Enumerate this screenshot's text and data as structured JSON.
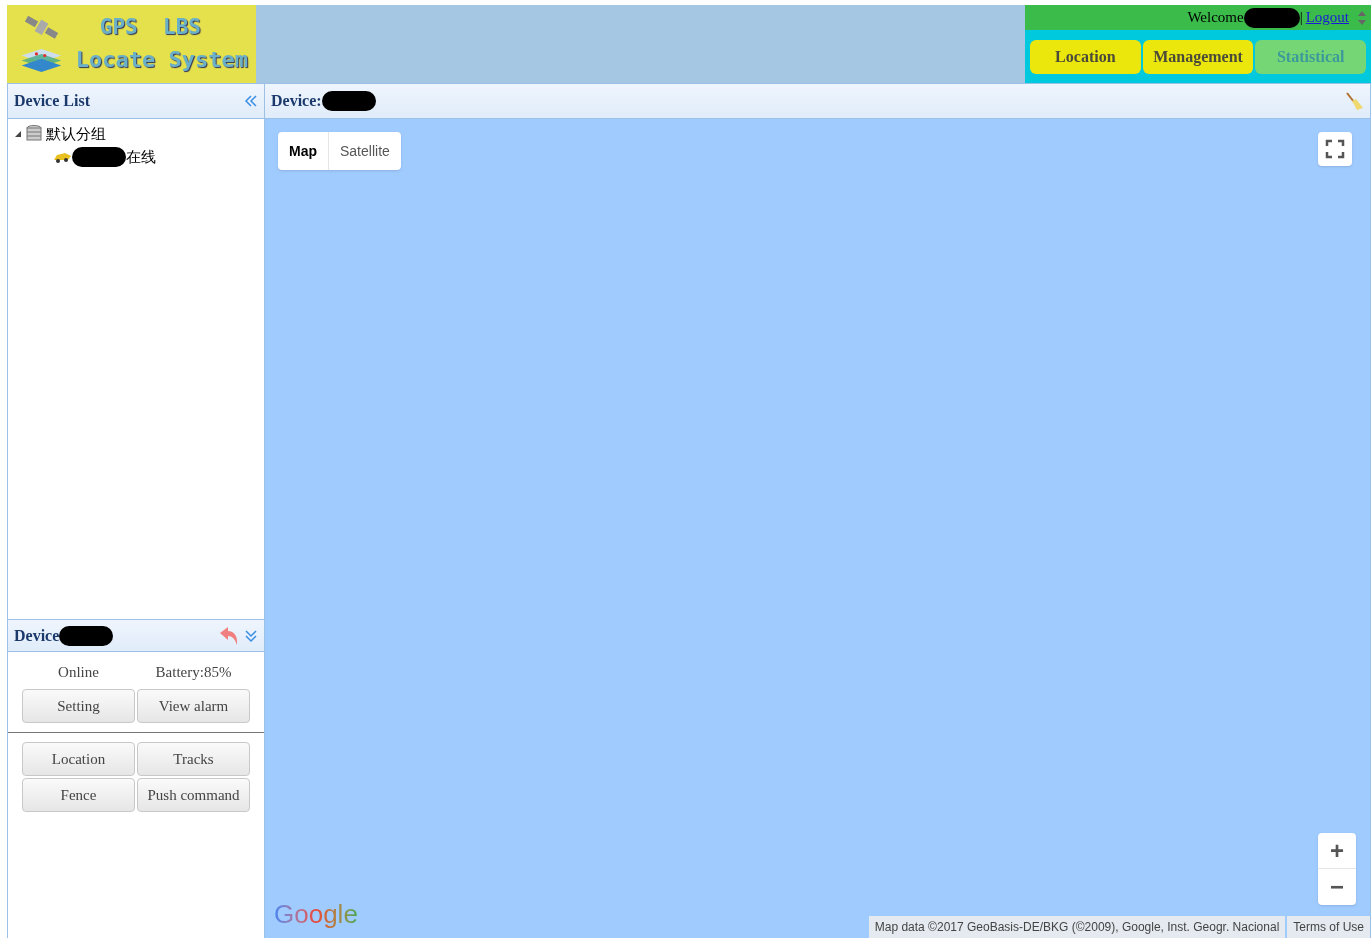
{
  "logo": {
    "line_1": "GPS  LBS",
    "line_2": "Locate System"
  },
  "user_bar": {
    "welcome": "Welcome",
    "separator": "|",
    "logout": "Logout"
  },
  "nav_tabs": [
    {
      "label": "Location",
      "selected": false
    },
    {
      "label": "Management",
      "selected": false
    },
    {
      "label": "Statistical",
      "selected": true
    }
  ],
  "device_list": {
    "title": "Device List",
    "tree": [
      {
        "label": "默认分组",
        "expanded": true,
        "children": [
          {
            "label": "在线"
          }
        ]
      }
    ]
  },
  "device_panel": {
    "title": "Device",
    "status": "Online",
    "battery": "Battery:85%",
    "buttons_top": [
      "Setting",
      "View alarm"
    ],
    "buttons_bottom": [
      "Location",
      "Tracks",
      "Fence",
      "Push command"
    ]
  },
  "map": {
    "title": "Device:",
    "map_types": [
      {
        "label": "Map",
        "selected": true
      },
      {
        "label": "Satellite",
        "selected": false
      }
    ],
    "zoom_in": "+",
    "zoom_out": "−",
    "logo": "Google",
    "attribution": "Map data ©2017 GeoBasis-DE/BKG (©2009), Google, Inst. Geogr. Nacional",
    "terms": "Terms of Use"
  }
}
